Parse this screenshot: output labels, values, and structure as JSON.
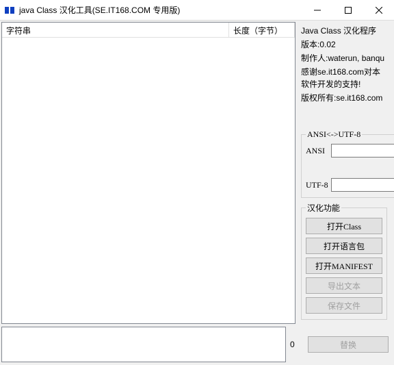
{
  "window": {
    "title": "java Class 汉化工具(SE.IT168.COM 专用版)"
  },
  "table": {
    "col1": "字符串",
    "col2": "长度（字节）"
  },
  "info": {
    "title": "Java Class 汉化程序",
    "version": "版本:0.02",
    "author": "制作人:waterun, banqu",
    "thanks1": "感谢se.it168.com对本软件开发的支持!",
    "copyright": "版权所有:se.it168.com"
  },
  "ansi": {
    "legend": "ANSI<->UTF-8",
    "label1": "ANSI",
    "label2": "UTF-8",
    "down": "↓",
    "up": "↑"
  },
  "actions": {
    "legend": "汉化功能",
    "open_class": "打开Class",
    "open_lang": "打开语言包",
    "open_manifest": "打开MANIFEST",
    "export_text": "导出文本",
    "save_file": "保存文件"
  },
  "bottom": {
    "count": "0",
    "replace": "替换"
  }
}
